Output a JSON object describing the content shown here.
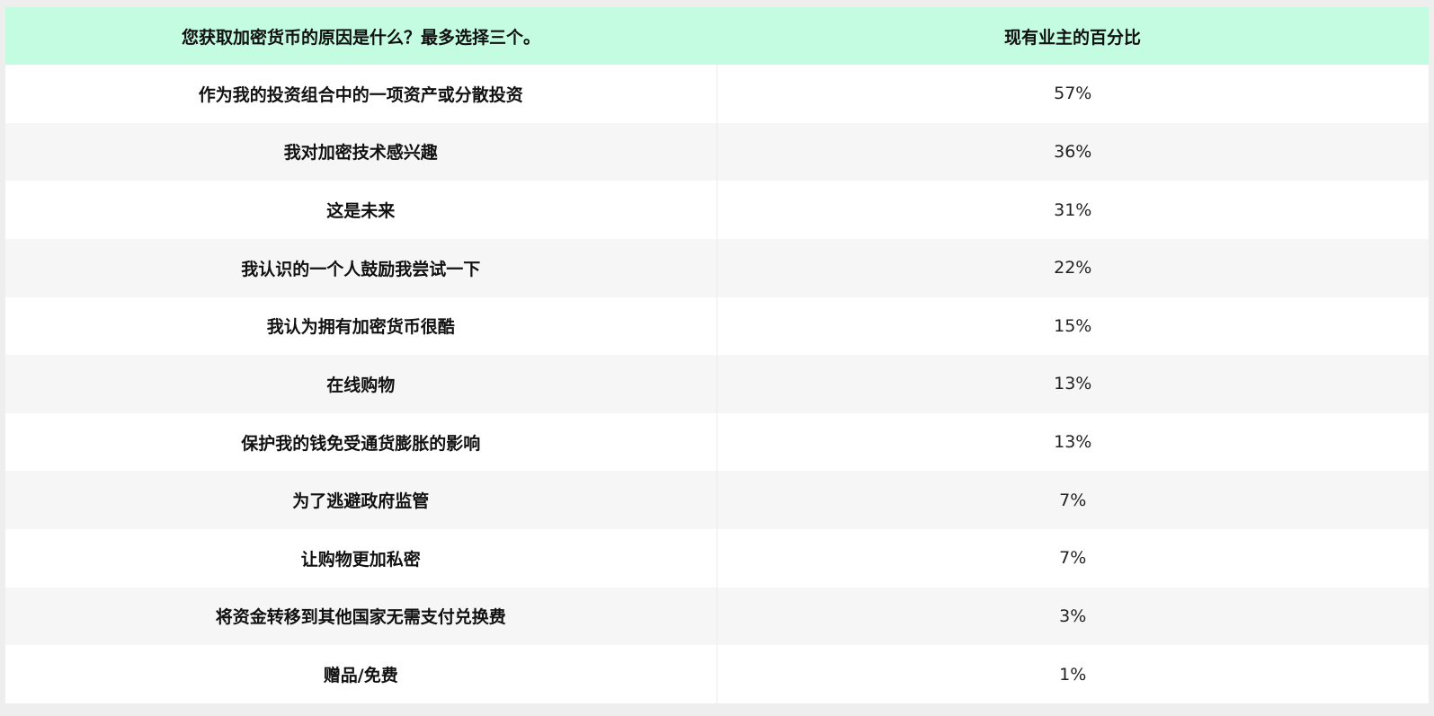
{
  "table": {
    "headers": {
      "reason": "您获取加密货币的原因是什么？最多选择三个。",
      "percent": "现有业主的百分比"
    },
    "rows": [
      {
        "reason": "作为我的投资组合中的一项资产或分散投资",
        "percent": "57%"
      },
      {
        "reason": "我对加密技术感兴趣",
        "percent": "36%"
      },
      {
        "reason": "这是未来",
        "percent": "31%"
      },
      {
        "reason": "我认识的一个人鼓励我尝试一下",
        "percent": "22%"
      },
      {
        "reason": "我认为拥有加密货币很酷",
        "percent": "15%"
      },
      {
        "reason": "在线购物",
        "percent": "13%"
      },
      {
        "reason": "保护我的钱免受通货膨胀的影响",
        "percent": "13%"
      },
      {
        "reason": "为了逃避政府监管",
        "percent": "7%"
      },
      {
        "reason": "让购物更加私密",
        "percent": "7%"
      },
      {
        "reason": "将资金转移到其他国家无需支付兑换费",
        "percent": "3%"
      },
      {
        "reason": "赠品/免费",
        "percent": "1%"
      }
    ]
  },
  "colors": {
    "header_bg": "#c3fce1",
    "row_alt_bg": "#f6f6f6",
    "row_bg": "#ffffff"
  }
}
